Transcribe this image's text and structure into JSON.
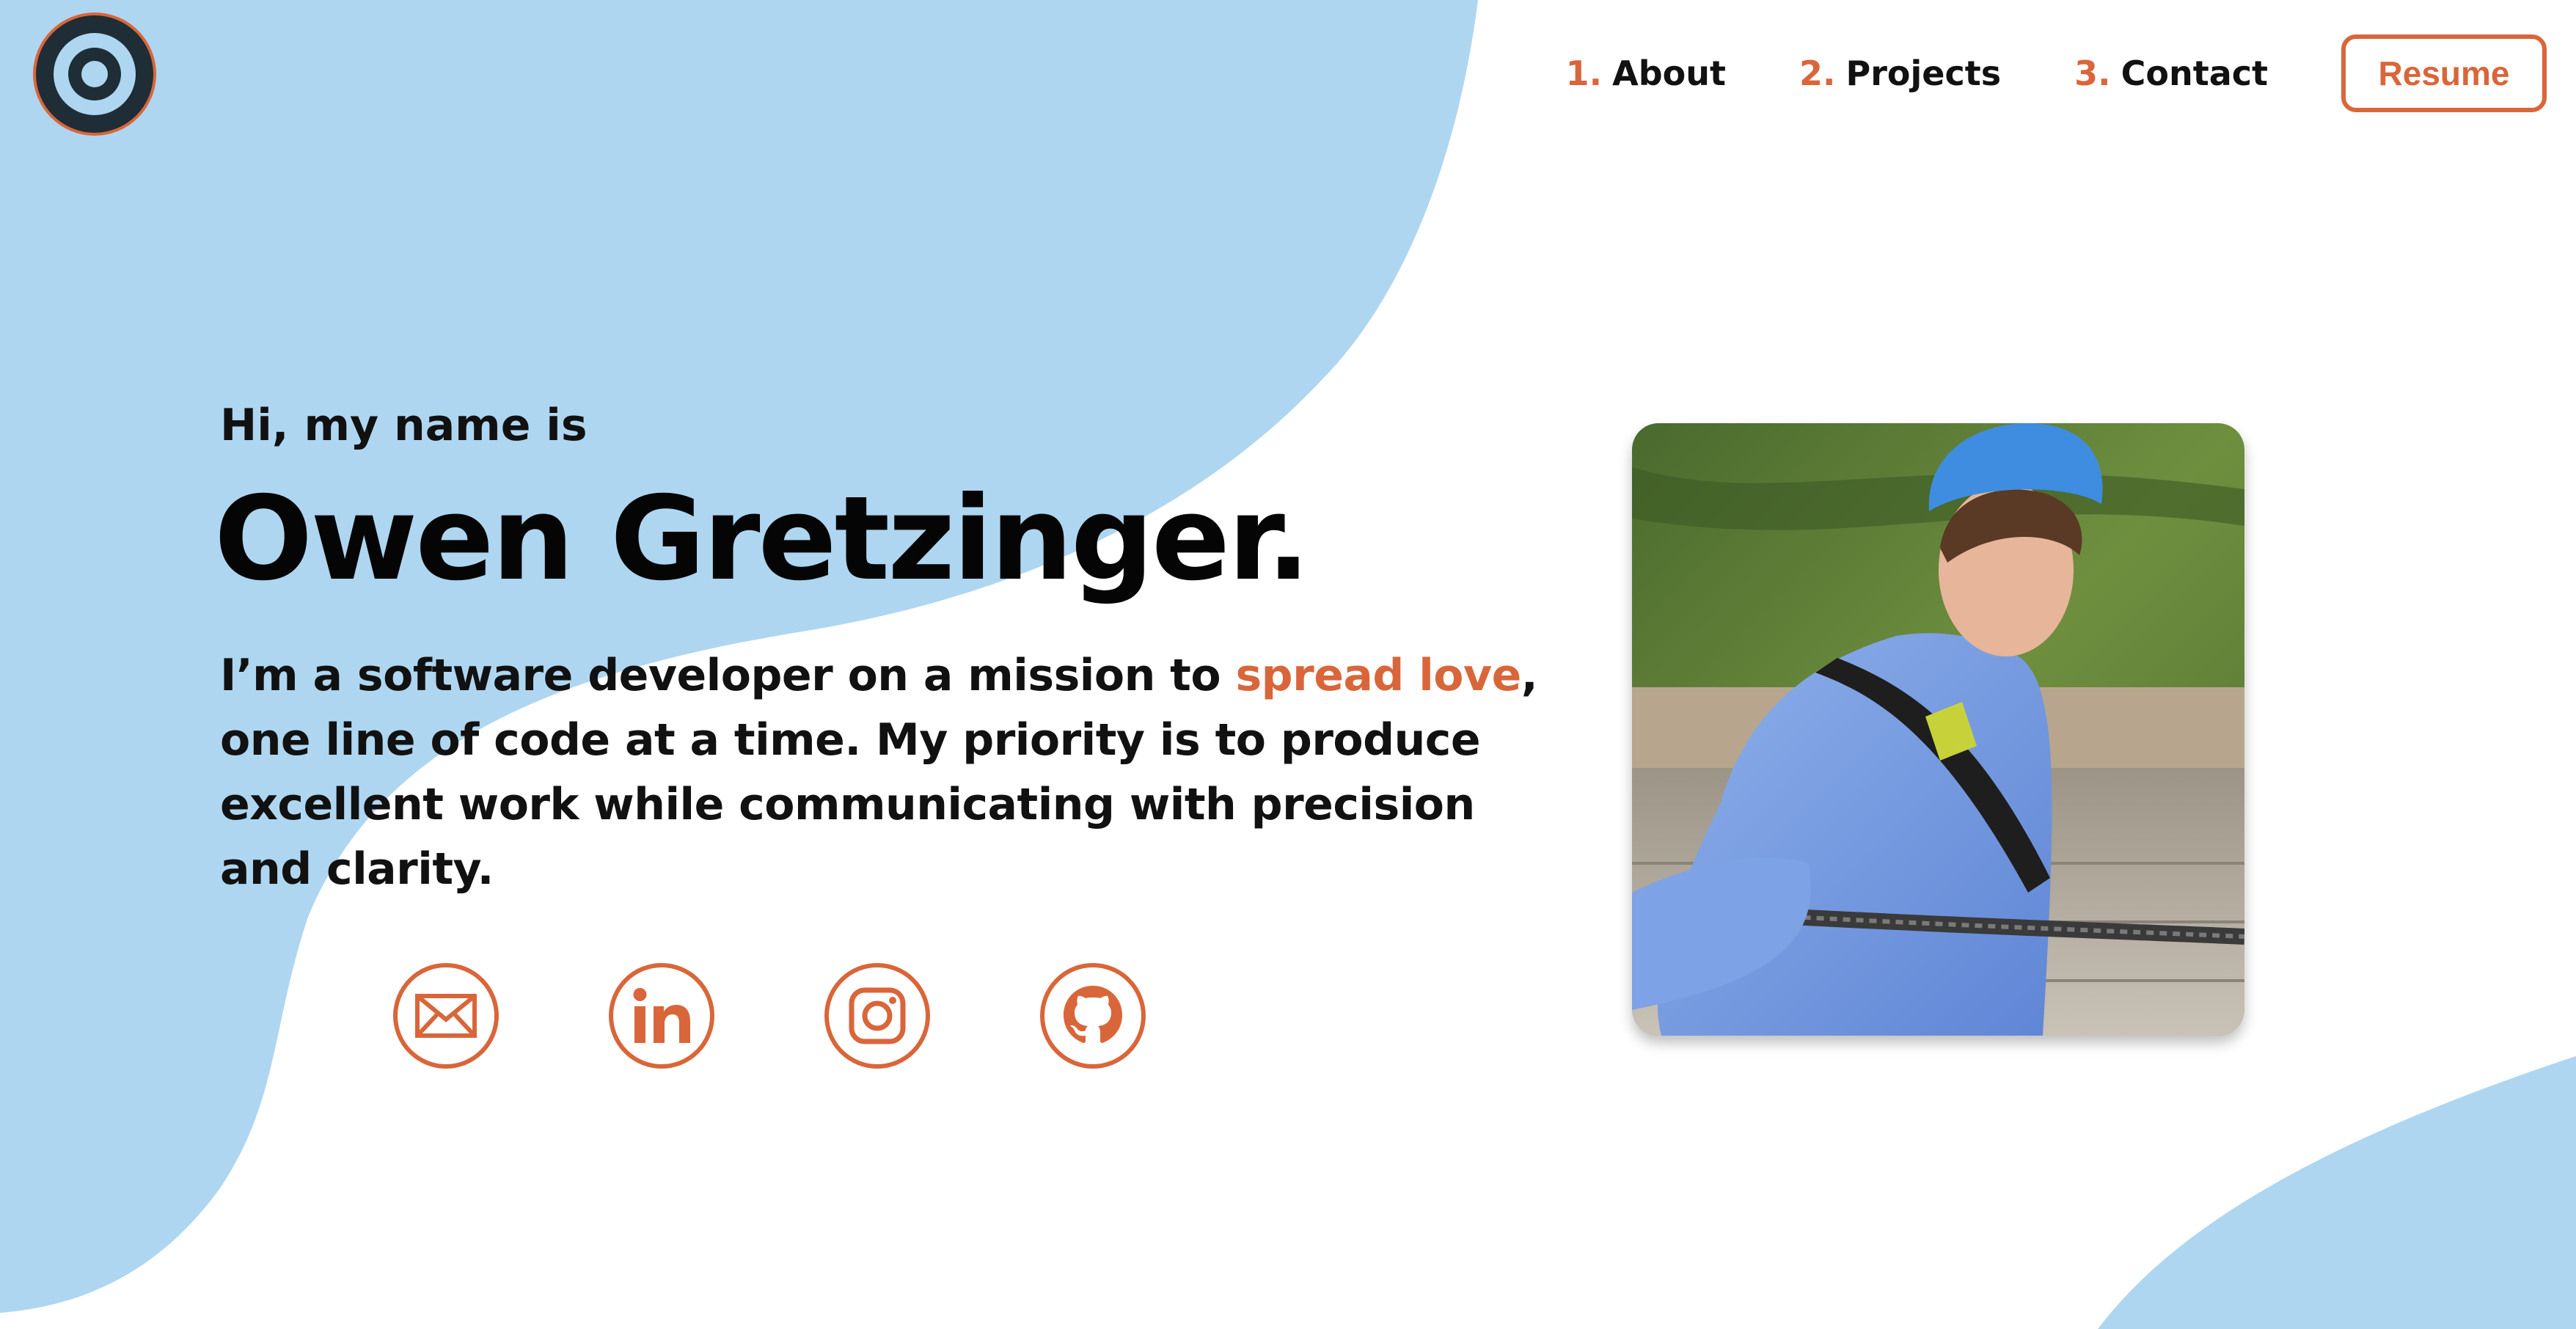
{
  "colors": {
    "accent": "#D9663A",
    "blob": "#AED6F0",
    "logo_dark": "#1F2D36",
    "logo_light": "#AED6F0"
  },
  "header": {
    "logo_icon": "concentric-circle-logo",
    "nav": [
      {
        "num": "1.",
        "label": "About"
      },
      {
        "num": "2.",
        "label": "Projects"
      },
      {
        "num": "3.",
        "label": "Contact"
      }
    ],
    "resume_label": "Resume"
  },
  "hero": {
    "greeting": "Hi, my name is",
    "name": "Owen Gretzinger.",
    "bio_before": "I’m a software developer on a mission to ",
    "bio_highlight": "spread love",
    "bio_after": ", one line of code at a time. My priority is to produce excellent work while communicating with precision and clarity."
  },
  "socials": [
    {
      "icon": "email-icon"
    },
    {
      "icon": "linkedin-icon"
    },
    {
      "icon": "instagram-icon"
    },
    {
      "icon": "github-icon"
    }
  ],
  "photo": {
    "subject": "profile-photo"
  }
}
